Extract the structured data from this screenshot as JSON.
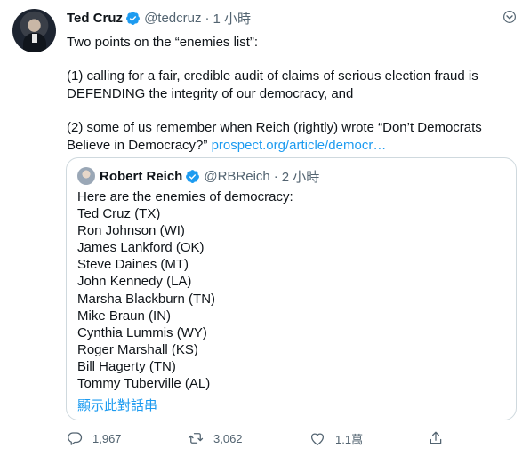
{
  "tweet": {
    "author_name": "Ted Cruz",
    "handle": "@tedcruz",
    "separator": "·",
    "time": "1 小時",
    "text_line1": "Two points on the “enemies list”:",
    "text_para2": "(1) calling for a fair, credible audit of claims of serious election fraud is DEFENDING the integrity of our democracy, and",
    "text_para3": "(2) some of us remember when Reich (rightly) wrote “Don’t Democrats Believe in Democracy?”",
    "link_text": "prospect.org/article/democr…"
  },
  "quoted": {
    "author_name": "Robert Reich",
    "handle": "@RBReich",
    "separator": "·",
    "time": "2 小時",
    "lines": [
      "Here are the enemies of democracy:",
      "Ted Cruz (TX)",
      "Ron Johnson (WI)",
      "James Lankford (OK)",
      "Steve Daines (MT)",
      "John Kennedy (LA)",
      "Marsha Blackburn (TN)",
      "Mike Braun (IN)",
      "Cynthia Lummis (WY)",
      "Roger Marshall (KS)",
      "Bill Hagerty (TN)",
      "Tommy Tuberville (AL)"
    ],
    "show_thread": "顯示此對話串"
  },
  "actions": {
    "replies": "1,967",
    "retweets": "3,062",
    "likes": "1.1萬"
  },
  "colors": {
    "accent": "#1d9bf0",
    "secondary_text": "#536471",
    "border": "#cfd9de"
  },
  "icons": [
    "verified-badge-icon",
    "chevron-down-icon",
    "reply-icon",
    "retweet-icon",
    "like-icon",
    "share-icon"
  ]
}
